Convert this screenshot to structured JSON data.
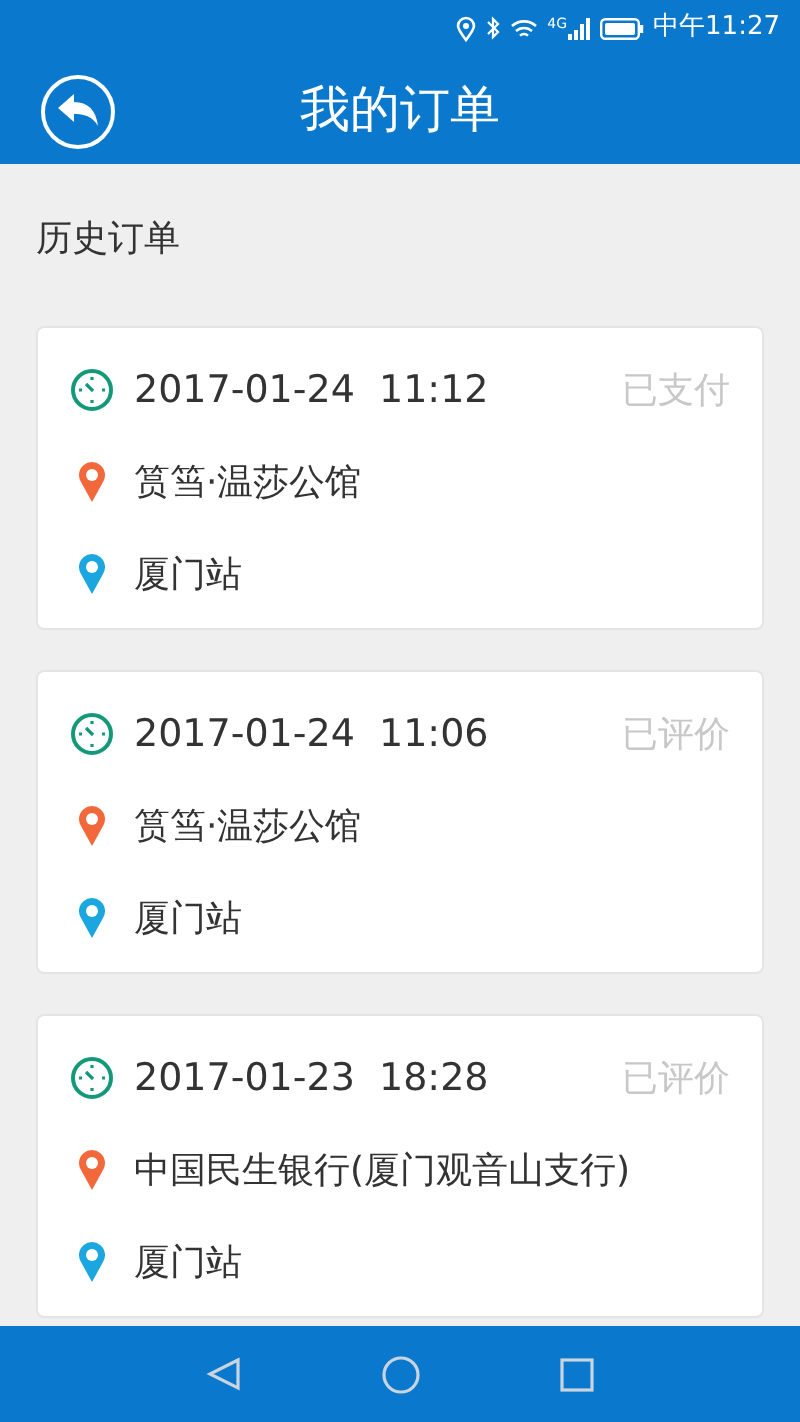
{
  "status_bar": {
    "network": "4G",
    "time": "中午11:27"
  },
  "header": {
    "title": "我的订单"
  },
  "section_title": "历史订单",
  "orders": [
    {
      "datetime": "2017-01-24  11:12",
      "status": "已支付",
      "origin": "筼筜·温莎公馆",
      "destination": "厦门站"
    },
    {
      "datetime": "2017-01-24  11:06",
      "status": "已评价",
      "origin": "筼筜·温莎公馆",
      "destination": "厦门站"
    },
    {
      "datetime": "2017-01-23  18:28",
      "status": "已评价",
      "origin": "中国民生银行(厦门观音山支行)",
      "destination": "厦门站"
    }
  ]
}
